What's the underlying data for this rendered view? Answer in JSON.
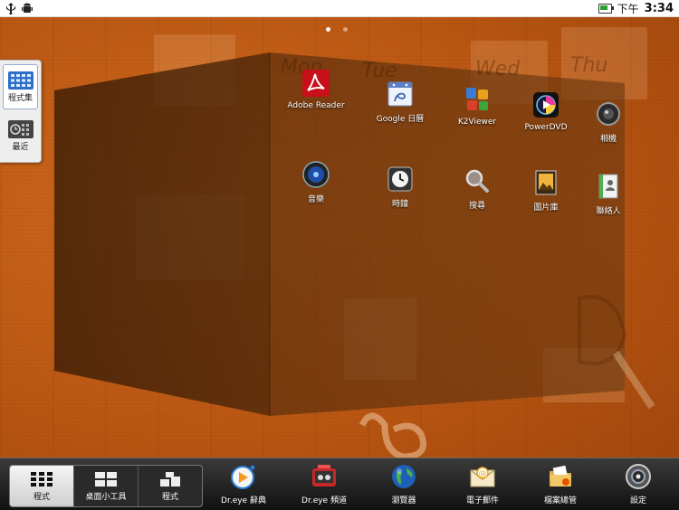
{
  "status_bar": {
    "left_icons": [
      "usb-icon",
      "android-debug-icon"
    ],
    "time_period": "下午",
    "time": "3:34",
    "battery_color": "#2ea02e"
  },
  "pager": {
    "page_count": 2,
    "active_page": 1
  },
  "side_panel": {
    "items": [
      {
        "label": "程式集",
        "icon": "grid-icon",
        "selected": true
      },
      {
        "label": "最近",
        "icon": "recent-clock-icon",
        "selected": false
      }
    ]
  },
  "apps": {
    "row1": [
      {
        "label": "Adobe Reader",
        "icon": "adobe-reader-icon"
      },
      {
        "label": "Google 日曆",
        "icon": "google-calendar-icon"
      },
      {
        "label": "K2Viewer",
        "icon": "k2viewer-icon"
      },
      {
        "label": "PowerDVD",
        "icon": "powerdvd-icon"
      },
      {
        "label": "相機",
        "icon": "camera-icon"
      }
    ],
    "row2": [
      {
        "label": "音樂",
        "icon": "music-icon"
      },
      {
        "label": "時鐘",
        "icon": "clock-icon"
      },
      {
        "label": "搜尋",
        "icon": "search-icon"
      },
      {
        "label": "圖片庫",
        "icon": "gallery-icon"
      },
      {
        "label": "聯絡人",
        "icon": "contacts-icon"
      }
    ]
  },
  "wallpaper_words": [
    "Mon",
    "Tue",
    "Wed",
    "Thu"
  ],
  "dock": {
    "segments": [
      {
        "label": "程式",
        "icon": "apps-grid-icon",
        "active": true
      },
      {
        "label": "桌面小工具",
        "icon": "widgets-icon",
        "active": false
      },
      {
        "label": "程式",
        "icon": "shortcuts-icon",
        "active": false
      }
    ],
    "apps": [
      {
        "label": "Dr.eye 辭典",
        "icon": "dreye-dictionary-icon"
      },
      {
        "label": "Dr.eye 頻道",
        "icon": "dreye-channel-icon"
      },
      {
        "label": "瀏覽器",
        "icon": "browser-globe-icon"
      },
      {
        "label": "電子郵件",
        "icon": "email-icon"
      },
      {
        "label": "檔案總管",
        "icon": "file-manager-icon"
      },
      {
        "label": "設定",
        "icon": "settings-icon"
      }
    ]
  }
}
